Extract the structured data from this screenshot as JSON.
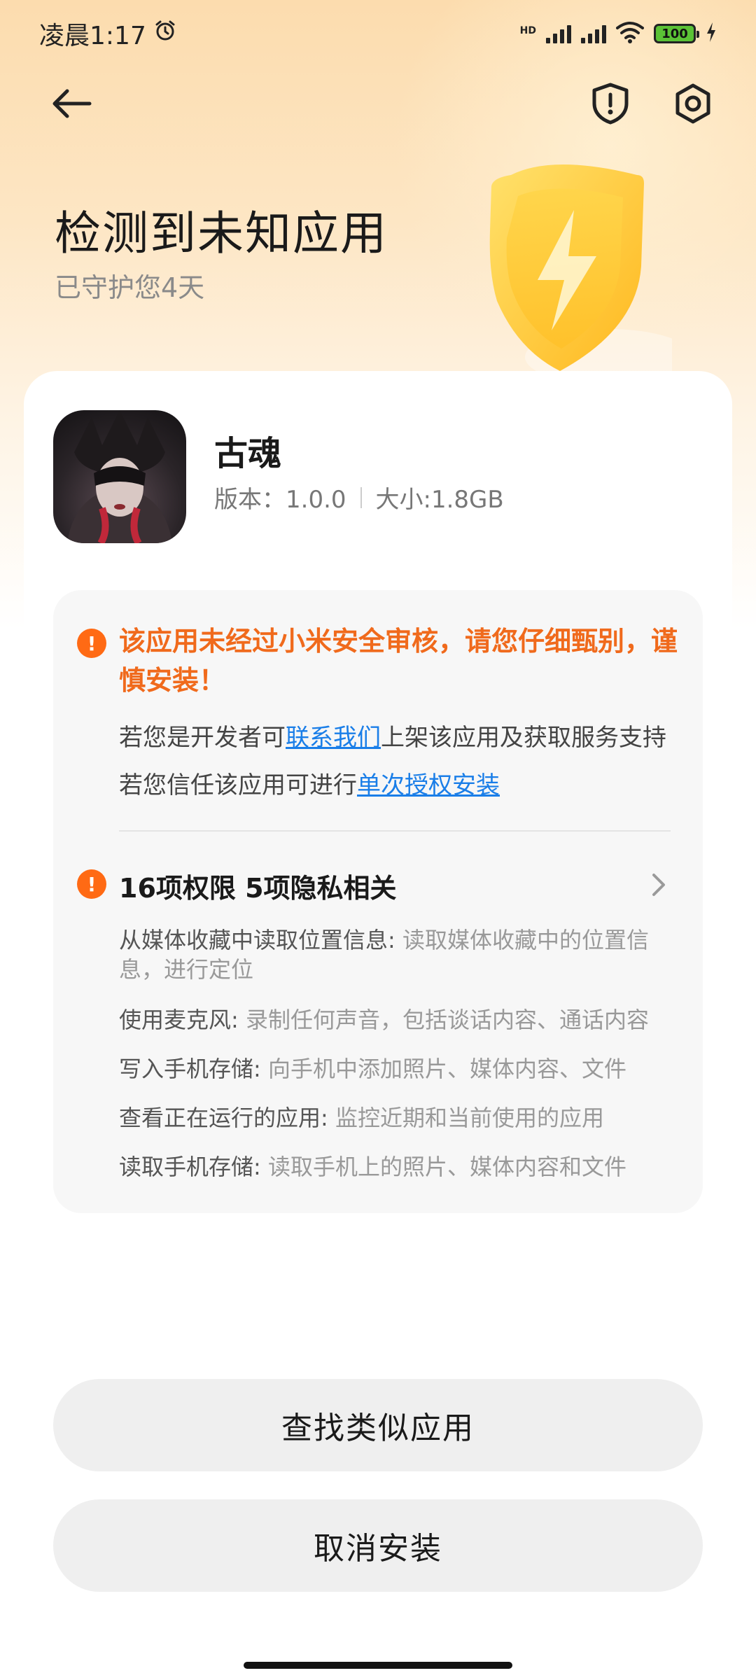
{
  "status_bar": {
    "time": "凌晨1:17",
    "network_label": "HD",
    "battery": "100"
  },
  "header": {
    "title": "检测到未知应用",
    "subtitle": "已守护您4天"
  },
  "app": {
    "name": "古魂",
    "version": "版本：1.0.0",
    "size": "大小:1.8GB"
  },
  "warning": {
    "message": "该应用未经过小米安全审核，请您仔细甄别，谨慎安装！",
    "dev_prefix": "若您是开发者可",
    "dev_link": "联系我们",
    "dev_suffix": "上架该应用及获取服务支持",
    "trust_prefix": "若您信任该应用可进行",
    "trust_link": "单次授权安装"
  },
  "permissions": {
    "summary": "16项权限 5项隐私相关",
    "items": [
      {
        "name": "从媒体收藏中读取位置信息:",
        "desc": "读取媒体收藏中的位置信息，进行定位"
      },
      {
        "name": "使用麦克风:",
        "desc": "录制任何声音，包括谈话内容、通话内容"
      },
      {
        "name": "写入手机存储:",
        "desc": "向手机中添加照片、媒体内容、文件"
      },
      {
        "name": "查看正在运行的应用:",
        "desc": "监控近期和当前使用的应用"
      },
      {
        "name": "读取手机存储:",
        "desc": "读取手机上的照片、媒体内容和文件"
      }
    ]
  },
  "buttons": {
    "find_similar": "查找类似应用",
    "cancel_install": "取消安装"
  },
  "colors": {
    "warning_orange": "#f06a1c",
    "link_blue": "#1a7ee8",
    "battery_green": "#5bc236"
  },
  "icons": [
    "back-arrow-icon",
    "shield-alert-icon",
    "settings-icon",
    "alarm-icon",
    "wifi-icon",
    "info-icon",
    "chevron-right-icon"
  ]
}
